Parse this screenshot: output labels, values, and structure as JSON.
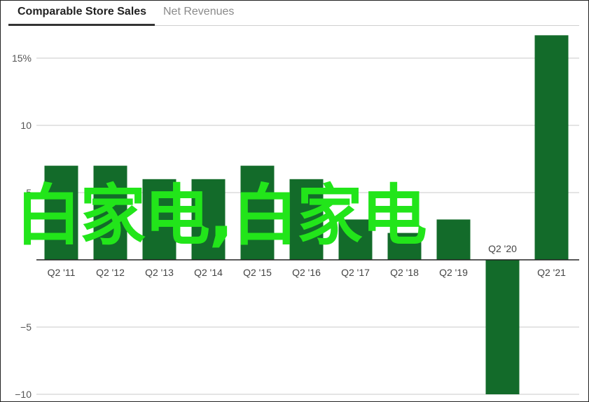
{
  "tabs": [
    {
      "label": "Comparable Store Sales",
      "active": true
    },
    {
      "label": "Net Revenues",
      "active": false
    }
  ],
  "overlay_text": "白家电,白家电",
  "colors": {
    "bar": "#136b2a",
    "grid": "#c8c8c8",
    "watermark": "#22e51a"
  },
  "chart_data": {
    "type": "bar",
    "categories": [
      "Q2 '11",
      "Q2 '12",
      "Q2 '13",
      "Q2 '14",
      "Q2 '15",
      "Q2 '16",
      "Q2 '17",
      "Q2 '18",
      "Q2 '19",
      "Q2 '20",
      "Q2 '21"
    ],
    "values": [
      7,
      7,
      6,
      6,
      7,
      6,
      3,
      2,
      3,
      -10,
      16.7
    ],
    "yticks": [
      {
        "value": 15,
        "label": "15%"
      },
      {
        "value": 10,
        "label": "10"
      },
      {
        "value": 5,
        "label": "5"
      },
      {
        "value": -5,
        "label": "−5"
      },
      {
        "value": -10,
        "label": "−10"
      }
    ],
    "ylim": [
      -10,
      16.7
    ],
    "title": "",
    "xlabel": "",
    "ylabel": "",
    "grid": true
  }
}
